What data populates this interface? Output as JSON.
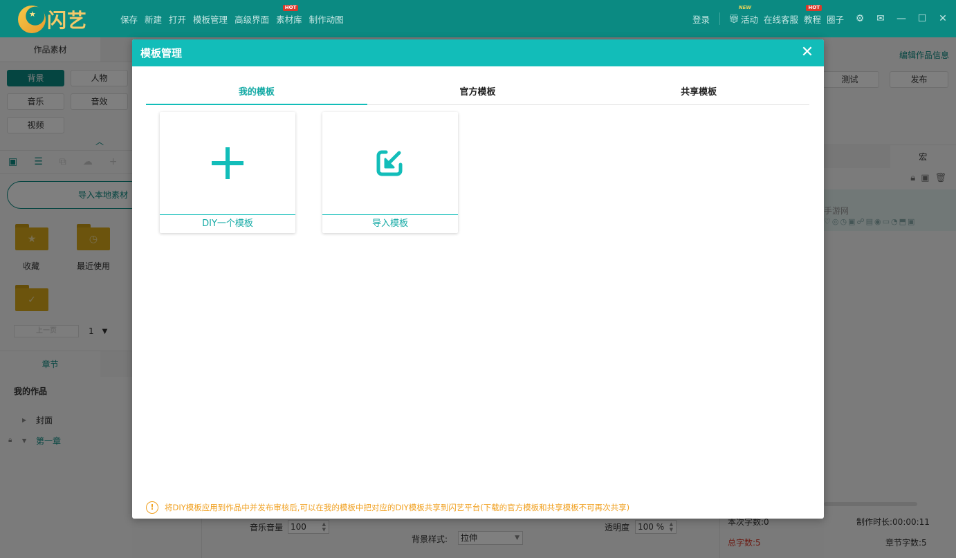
{
  "app": {
    "logo_text": "闪艺",
    "menu": [
      {
        "label": "保存",
        "badge": ""
      },
      {
        "label": "新建",
        "badge": ""
      },
      {
        "label": "打开",
        "badge": ""
      },
      {
        "label": "模板管理",
        "badge": ""
      },
      {
        "label": "高级界面",
        "badge": ""
      },
      {
        "label": "素材库",
        "badge": "HOT"
      },
      {
        "label": "制作动图",
        "badge": ""
      }
    ],
    "right_menu": {
      "login": "登录",
      "activity": "活动",
      "activity_badge": "NEW",
      "support": "在线客服",
      "tutorial": "教程",
      "tutorial_badge": "HOT",
      "circle": "圈子"
    }
  },
  "left_panel": {
    "tab": "作品素材",
    "categories": [
      "背景",
      "人物",
      "音乐",
      "音效",
      "视频"
    ],
    "import_local": "导入本地素材",
    "folders": [
      "收藏",
      "最近使用"
    ],
    "pager_prev": "上一页",
    "pager_page": "1",
    "chapter_tab": "章节",
    "works_title": "我的作品",
    "tree": [
      "封面",
      "第一章"
    ]
  },
  "right_panel": {
    "edit_info": "编辑作品信息",
    "test": "测试",
    "publish": "发布",
    "tab_macro": "宏",
    "item_text": "手游网",
    "item_icons": "♡◎◷▣☍▤◉▭◔⬒▣"
  },
  "bottom": {
    "music_volume_label": "音乐音量",
    "music_volume": "100",
    "opacity_label": "透明度",
    "opacity": "100 %",
    "bg_style_label": "背景样式:",
    "bg_style": "拉伸",
    "this_words": "本次字数:0",
    "total_words": "总字数:5",
    "duration": "制作时长:00:00:11",
    "chapter_words": "章节字数:5"
  },
  "dialog": {
    "title": "模板管理",
    "tabs": [
      "我的模板",
      "官方模板",
      "共享模板"
    ],
    "active_tab": 0,
    "cards": [
      {
        "label": "DIY一个模板",
        "icon": "plus-icon"
      },
      {
        "label": "导入模板",
        "icon": "import-icon"
      }
    ],
    "notice": "将DIY模板应用到作品中并发布审核后,可以在我的模板中把对应的DIY模板共享到闪艺平台(下载的官方模板和共享模板不可再次共享)"
  },
  "colors": {
    "titlebar": "#0b8a82",
    "dialog_header": "#12bdb9",
    "accent": "#12a9a4",
    "notice": "#f0a020"
  }
}
